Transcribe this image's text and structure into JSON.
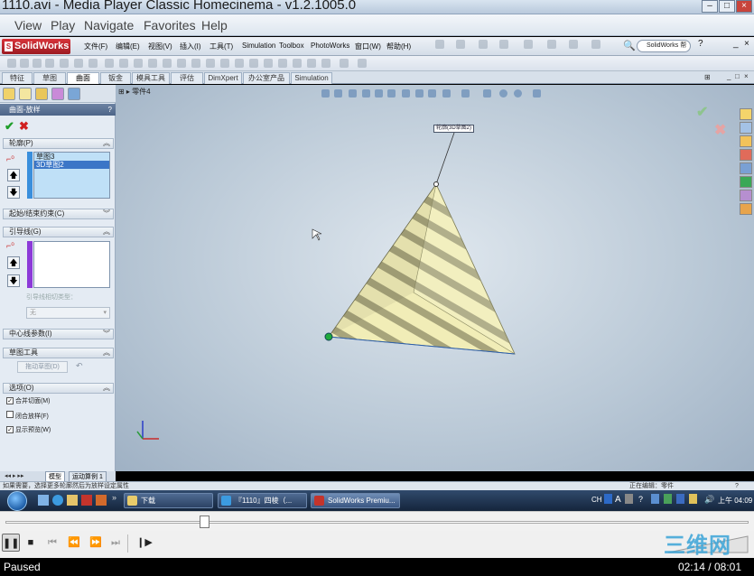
{
  "mpc": {
    "title": "1110.avi - Media Player Classic Homecinema - v1.2.1005.0",
    "menu": [
      "View",
      "Play",
      "Navigate",
      "Favorites",
      "Help"
    ],
    "status": "Paused",
    "time": "02:14 / 08:01",
    "watermark": "三维网"
  },
  "sw": {
    "logo": "SolidWorks",
    "menu": [
      "文件(F)",
      "编辑(E)",
      "视图(V)",
      "插入(I)",
      "工具(T)",
      "Simulation",
      "Toolbox",
      "PhotoWorks",
      "窗口(W)",
      "帮助(H)"
    ],
    "search": "SolidWorks 帮",
    "tabs": [
      "特征",
      "草图",
      "曲面",
      "钣金",
      "模具工具",
      "评估",
      "DimXpert",
      "办公室产品",
      "Simulation"
    ],
    "active_tab": "曲面",
    "tree_node": "零件4",
    "feature_title": "曲面-放样",
    "callout": "轮廓(3D草图2)",
    "panel": {
      "profiles_header": "轮廓(P)",
      "profiles": [
        "草图3",
        "3D草图2"
      ],
      "constraints_header": "起始/结束约束(C)",
      "guides_header": "引导线(G)",
      "guide_tangency_label": "引导线相切类型：",
      "guide_tangency_value": "无",
      "centerline_header": "中心线参数(I)",
      "sketch_tools_header": "草图工具",
      "drag_sketch": "拖动草图(D)",
      "options_header": "选项(O)",
      "options": [
        {
          "label": "合并切面(M)",
          "checked": true
        },
        {
          "label": "闭合放样(F)",
          "checked": false
        },
        {
          "label": "显示预览(W)",
          "checked": true
        }
      ]
    },
    "bottom_tabs": [
      "模型",
      "运动算例 1"
    ],
    "status_text": "如果需要，选择更多轮廓然后为放样设定属性",
    "status_mode": "正在编辑：零件"
  },
  "taskbar": {
    "buttons": [
      "下载",
      "『1110』四棱（...",
      "SolidWorks Premiu..."
    ],
    "ime": "CH",
    "clock": "上午 04:09"
  }
}
